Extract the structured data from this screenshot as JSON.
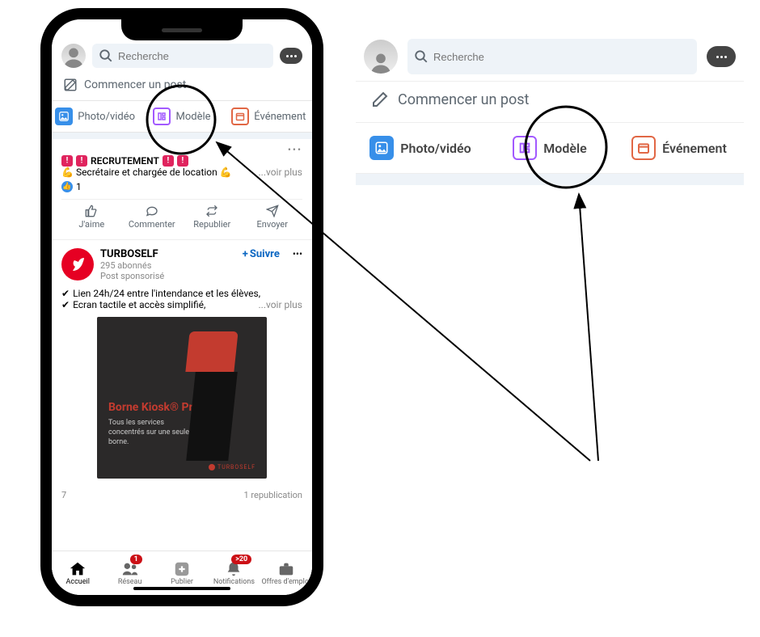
{
  "search": {
    "placeholder": "Recherche"
  },
  "compose": {
    "label": "Commencer un post"
  },
  "post_options": {
    "photo": "Photo/vidéo",
    "model": "Modèle",
    "event": "Événement"
  },
  "feed": {
    "recruit": {
      "line1": "RECRUTEMENT",
      "line2": "Secrétaire et chargée de location",
      "see_more": "...voir plus",
      "reactions": "1"
    },
    "actions": {
      "like": "J'aime",
      "comment": "Commenter",
      "repost": "Republier",
      "send": "Envoyer"
    },
    "sponsor": {
      "name": "TURBOSELF",
      "followers": "295 abonnés",
      "tag": "Post sponsorisé",
      "follow": "Suivre",
      "line1": "Lien 24h/24 entre l'intendance et les élèves,",
      "line2": "Ecran tactile et accès simplifié,",
      "see_more": "...voir plus",
      "promo_title": "Borne Kiosk® Premium",
      "promo_sub": "Tous les services concentrés sur une seule borne.",
      "promo_brand": "TURBOSELF",
      "left_count": "7",
      "right_count": "1 republication"
    }
  },
  "nav": {
    "home": "Accueil",
    "network": "Réseau",
    "publish": "Publier",
    "notifications": "Notifications",
    "jobs": "Offres d'emploi",
    "network_badge": "1",
    "notif_badge": ">20"
  }
}
